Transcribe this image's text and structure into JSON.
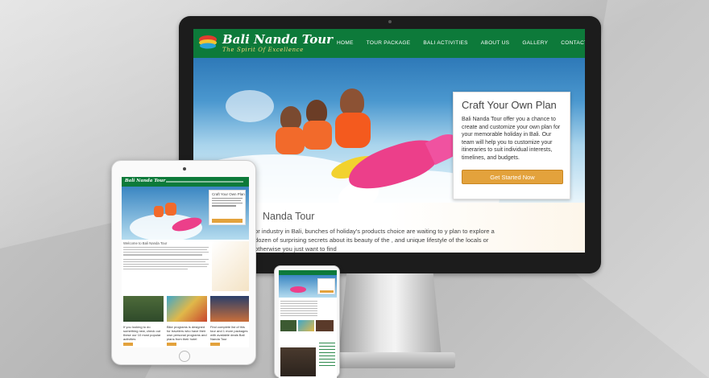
{
  "site": {
    "brand": "Bali Nanda Tour",
    "tagline": "The Spirit Of Excellence",
    "nav": [
      "HOME",
      "TOUR PACKAGE",
      "BALI ACTIVITIES",
      "ABOUT US",
      "GALLERY",
      "CONTACT"
    ]
  },
  "plan": {
    "title": "Craft Your Own Plan",
    "body": "Bali Nanda Tour offer you a chance to create and customize your own plan for your memorable holiday in Bali. Our team will help you to customize your itineraries to suit individual interests, timelines, and budgets.",
    "button": "Get Started Now"
  },
  "welcome": {
    "title": "Nanda Tour",
    "text": "or industry in Bali, bunches of holiday's products choice are waiting to y plan to explore a dozen of surprising secrets about its beauty of the , and unique lifestyle of the locals or otherwise you just want to find"
  },
  "tablet": {
    "brand": "Bali Nanda Tour",
    "plan_title": "Craft Your Own Plan",
    "welcome": "Welcome to Bali Nanda Tour",
    "captions": [
      "If you looking to do something new, check out these our 10 most popular activities",
      "Bike programs is designed for travelers who have their own personal programs and plans from their hotel",
      "Find complete list of this tour and 1 more packages with available deals Bali Nanda Tour"
    ]
  },
  "colors": {
    "brand_green": "#0d7a3a",
    "accent_orange": "#e3a23c",
    "banana_pink": "#ec3f8a"
  }
}
